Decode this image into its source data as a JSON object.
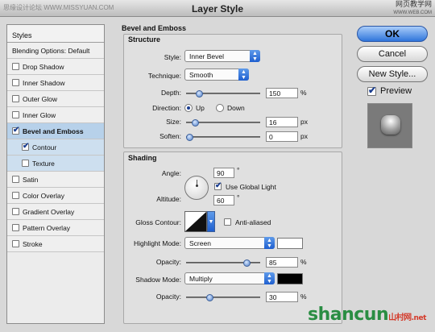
{
  "window": {
    "title": "Layer Style"
  },
  "watermark": {
    "left": "思缘设计论坛 WWW.MISSYUAN.COM",
    "right_top": "网页教学网",
    "right_sub": "WWW.WEB.COM",
    "brand": "shancun",
    "brand_cn": "山村网",
    "brand_net": ".net"
  },
  "stylelist": {
    "header": "Styles",
    "blending": "Blending Options: Default",
    "items": [
      {
        "label": "Drop Shadow",
        "checked": false
      },
      {
        "label": "Inner Shadow",
        "checked": false
      },
      {
        "label": "Outer Glow",
        "checked": false
      },
      {
        "label": "Inner Glow",
        "checked": false
      },
      {
        "label": "Bevel and Emboss",
        "checked": true
      },
      {
        "label": "Contour",
        "checked": true
      },
      {
        "label": "Texture",
        "checked": false
      },
      {
        "label": "Satin",
        "checked": false
      },
      {
        "label": "Color Overlay",
        "checked": false
      },
      {
        "label": "Gradient Overlay",
        "checked": false
      },
      {
        "label": "Pattern Overlay",
        "checked": false
      },
      {
        "label": "Stroke",
        "checked": false
      }
    ]
  },
  "bevel": {
    "section": "Bevel and Emboss",
    "structure": "Structure",
    "style_label": "Style:",
    "style_value": "Inner Bevel",
    "technique_label": "Technique:",
    "technique_value": "Smooth",
    "depth_label": "Depth:",
    "depth_value": "150",
    "depth_unit": "%",
    "depth_pct": 0.15,
    "direction_label": "Direction:",
    "up_label": "Up",
    "down_label": "Down",
    "direction": "Up",
    "size_label": "Size:",
    "size_value": "16",
    "size_unit": "px",
    "size_pct": 0.08,
    "soften_label": "Soften:",
    "soften_value": "0",
    "soften_unit": "px",
    "soften_pct": 0.0
  },
  "shading": {
    "title": "Shading",
    "angle_label": "Angle:",
    "angle_value": "90",
    "angle_unit": "°",
    "global_light_label": "Use Global Light",
    "global_light": true,
    "altitude_label": "Altitude:",
    "altitude_value": "60",
    "altitude_unit": "°",
    "gloss_label": "Gloss Contour:",
    "anti_aliased_label": "Anti-aliased",
    "anti_aliased": false,
    "highlight_mode_label": "Highlight Mode:",
    "highlight_mode": "Screen",
    "highlight_color": "#ffffff",
    "highlight_opacity_label": "Opacity:",
    "highlight_opacity": "85",
    "highlight_opacity_pct": 0.85,
    "shadow_mode_label": "Shadow Mode:",
    "shadow_mode": "Multiply",
    "shadow_color": "#000000",
    "shadow_opacity_label": "Opacity:",
    "shadow_opacity": "30",
    "shadow_opacity_pct": 0.3,
    "pct_unit": "%"
  },
  "buttons": {
    "ok": "OK",
    "cancel": "Cancel",
    "new_style": "New Style...",
    "preview": "Preview",
    "preview_checked": true
  }
}
